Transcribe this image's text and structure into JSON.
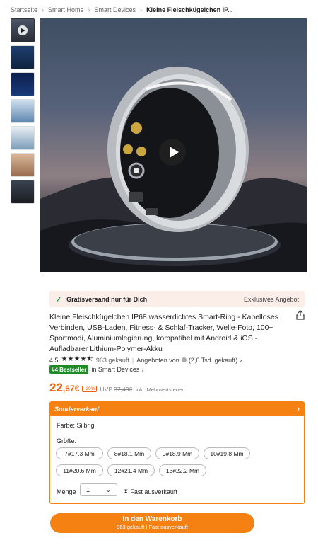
{
  "breadcrumb": {
    "items": [
      "Startseite",
      "Smart Home",
      "Smart Devices"
    ],
    "current": "Kleine Fleischkügelchen IP...",
    "separator": "›"
  },
  "shipping": {
    "text": "Gratisversand nur für Dich",
    "exclusive": "Exklusives Angebot"
  },
  "product": {
    "title": "Kleine Fleischkügelchen IP68 wasserdichtes Smart-Ring - Kabelloses Verbinden, USB-Laden, Fitness- & Schlaf-Tracker, Welle-Foto, 100+ Sportmodi, Aluminiumlegierung, kompatibel mit Android & iOS - Aufladbarer Lithium-Polymer-Akku",
    "rating_value": "4,5",
    "stars": "★★★★⯪",
    "sold": "963 gekauft",
    "offered_by": "Angeboten von",
    "seller_sold": "(2,6 Tsd. gekauft)",
    "bestseller_badge": "#4 Bestseller",
    "bestseller_in": "in Smart Devices",
    "price_int": "22",
    "price_dec": ",67€",
    "discount": "-39%",
    "uvp_label": "UVP",
    "uvp_price": "37,49€",
    "incl_tax": "inkl. Mehrwertsteuer"
  },
  "special": {
    "header": "Sonderverkauf",
    "color_label": "Farbe: Silbrig",
    "size_label": "Größe:",
    "sizes": [
      "7#17.3 Mm",
      "8#18.1 Mm",
      "9#18.9 Mm",
      "10#19.8 Mm",
      "11#20.6 Mm",
      "12#21.4 Mm",
      "13#22.2 Mm"
    ],
    "qty_label": "Menge",
    "qty_value": "1",
    "soldout_text": "Fast ausverkauft"
  },
  "cart": {
    "label": "In den Warenkorb",
    "sub": "963 gekauft | Fast ausverkauft"
  },
  "colors": {
    "accent": "#f58113",
    "price": "#f2610b",
    "badge_green": "#1f8b24",
    "shipping_bg": "#fbeee9"
  },
  "icons": {
    "share": "share-icon",
    "play": "play-icon",
    "check": "check-icon",
    "hourglass": "hourglass-icon",
    "chevron": "chevron-right-icon"
  }
}
